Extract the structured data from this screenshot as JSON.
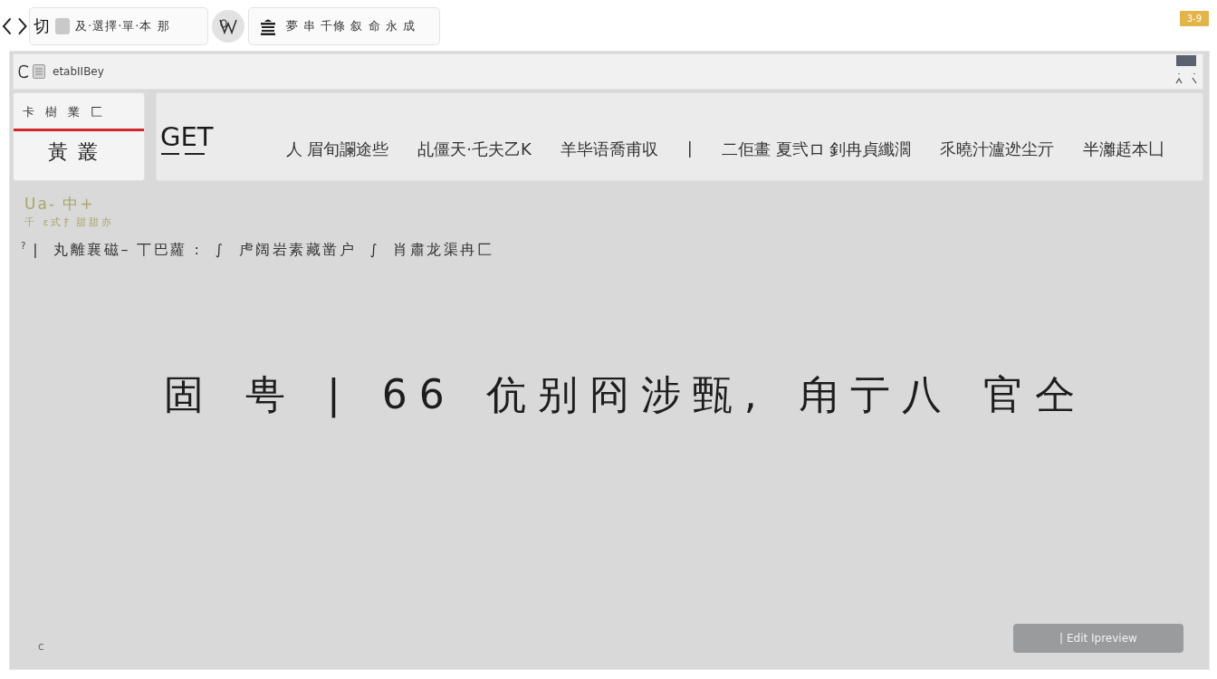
{
  "browser": {
    "tabs": [
      {
        "lead": "切",
        "label": "及·選擇·單·本 那"
      },
      {
        "label": "夢 串 千條 叙 命 永 成"
      }
    ],
    "badge": "3-9"
  },
  "address_bar": {
    "url": "etabIIBey"
  },
  "section_card": {
    "caption": "卡 樹 業 匚",
    "title": "黃 叢"
  },
  "request_panel": {
    "method": "GET",
    "segments": [
      "人 眉旬讕途些",
      "乩僵天·乇夫乙K",
      "羊毕语喬甫収",
      "|",
      "二佢畫 夏弐ロ 釗冉貞纖濶",
      "乑曉汁瀘迯尘亓",
      "半灕趏本凵"
    ]
  },
  "notes": {
    "heading": "Ua- 中+",
    "subheading": "千 ɛ式扌甜甜亦"
  },
  "summary": {
    "marker": "?",
    "text": "|  丸離襄磁– 丅巴蘿 :  ∫  虍阔岩素藏凿户  ∫  肖肅龙渠冉匚"
  },
  "headline": "固 甹 | 66 伉别冏涉甄, 甪亍八 官仝",
  "footer": {
    "corner_text": "c",
    "button": "| Edit Ipreview"
  }
}
